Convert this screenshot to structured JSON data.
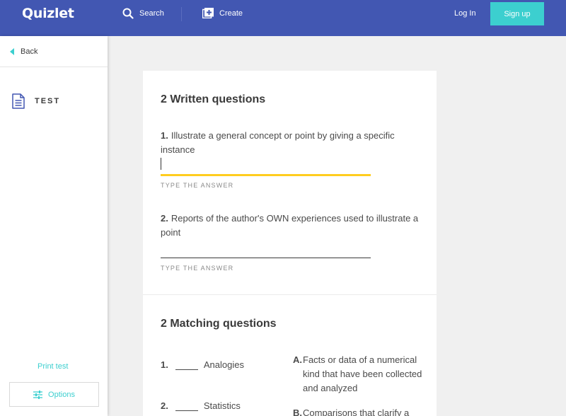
{
  "header": {
    "logo": "Quizlet",
    "search_label": "Search",
    "create_label": "Create",
    "login_label": "Log In",
    "signup_label": "Sign up"
  },
  "sidebar": {
    "back_label": "Back",
    "test_label": "TEST",
    "print_label": "Print test",
    "options_label": "Options"
  },
  "written": {
    "title": "2 Written questions",
    "hint": "TYPE THE ANSWER",
    "questions": [
      {
        "num": "1.",
        "text": "Illustrate a general concept or point by giving a specific instance"
      },
      {
        "num": "2.",
        "text": "Reports of the author's OWN experiences used to illustrate a point"
      }
    ]
  },
  "matching": {
    "title": "2 Matching questions",
    "items": [
      {
        "num": "1.",
        "term": "Analogies"
      },
      {
        "num": "2.",
        "term": "Statistics"
      }
    ],
    "options": [
      {
        "letter": "A.",
        "text": "Facts or data of a numerical kind that have been collected and analyzed"
      },
      {
        "letter": "B.",
        "text": "Comparisons that clarify a"
      }
    ]
  },
  "colors": {
    "brand": "#4257b2",
    "accent": "#3ccfcf",
    "active_underline": "#ffcd1f"
  }
}
